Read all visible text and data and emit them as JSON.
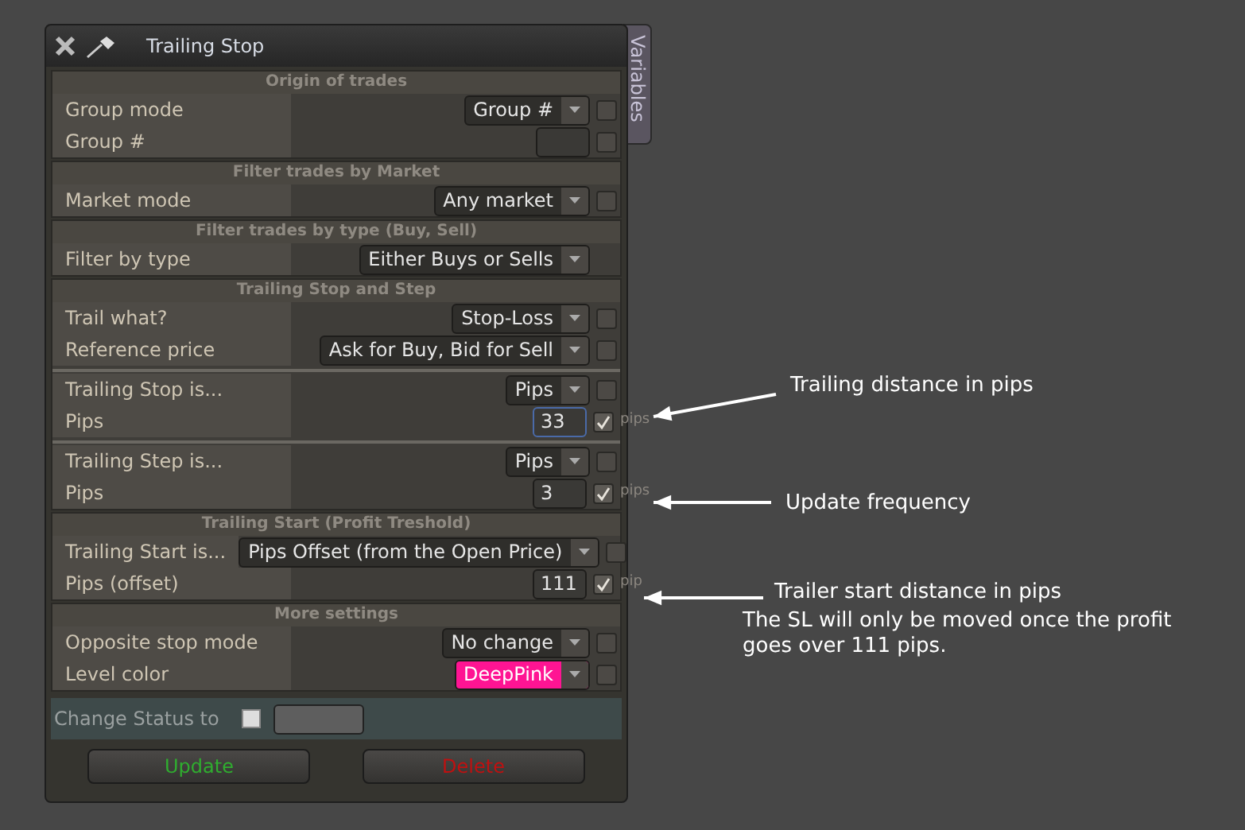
{
  "window": {
    "title": "Trailing Stop",
    "side_tab": "Variables"
  },
  "sections": [
    {
      "title": "Origin of trades",
      "groups": [
        [
          {
            "label": "Group mode",
            "kind": "dropdown",
            "value": "Group #",
            "checked": false
          },
          {
            "label": "Group #",
            "kind": "input",
            "checked": false
          }
        ]
      ]
    },
    {
      "title": "Filter trades by Market",
      "groups": [
        [
          {
            "label": "Market mode",
            "kind": "dropdown",
            "value": "Any market",
            "checked": false
          }
        ]
      ]
    },
    {
      "title": "Filter trades by type (Buy, Sell)",
      "groups": [
        [
          {
            "label": "Filter by type",
            "kind": "dropdown",
            "value": "Either Buys or Sells"
          }
        ]
      ]
    },
    {
      "title": "Trailing Stop and Step",
      "groups": [
        [
          {
            "label": "Trail what?",
            "kind": "dropdown",
            "value": "Stop-Loss",
            "checked": false
          },
          {
            "label": "Reference price",
            "kind": "dropdown",
            "value": "Ask for Buy, Bid for Sell",
            "checked": false
          }
        ],
        [
          {
            "label": "Trailing Stop is...",
            "kind": "dropdown",
            "value": "Pips",
            "checked": false
          },
          {
            "label": "Pips",
            "kind": "input",
            "value": "33",
            "focused": true,
            "checked": true,
            "unit": "pips"
          }
        ],
        [
          {
            "label": "Trailing Step is...",
            "kind": "dropdown",
            "value": "Pips",
            "checked": false
          },
          {
            "label": "Pips",
            "kind": "input",
            "value": "3",
            "focused": false,
            "checked": true,
            "unit": "pips"
          }
        ]
      ]
    },
    {
      "title": "Trailing Start (Profit Treshold)",
      "groups": [
        [
          {
            "label": "Trailing Start is...",
            "kind": "dropdown",
            "value": "Pips Offset (from the Open Price)",
            "checked": false
          },
          {
            "label": "Pips (offset)",
            "kind": "input",
            "value": "111",
            "focused": false,
            "checked": true,
            "unit": "pip"
          }
        ]
      ]
    },
    {
      "title": "More settings",
      "groups": [
        [
          {
            "label": "Opposite stop mode",
            "kind": "dropdown",
            "value": "No change",
            "checked": false
          },
          {
            "label": "Level color",
            "kind": "dropdown",
            "value": "DeepPink",
            "color": "#ff1493",
            "checked": false
          }
        ]
      ]
    }
  ],
  "status": {
    "label": "Change Status to",
    "checked": false
  },
  "buttons": [
    {
      "label": "Update",
      "kind": "update"
    },
    {
      "label": "Delete",
      "kind": "delete"
    }
  ],
  "annotations": [
    {
      "text": "Trailing distance in pips"
    },
    {
      "text": "Update frequency"
    },
    {
      "text": "Trailer start distance in pips",
      "note": "The SL will only be moved once the profit goes over 111 pips."
    }
  ]
}
